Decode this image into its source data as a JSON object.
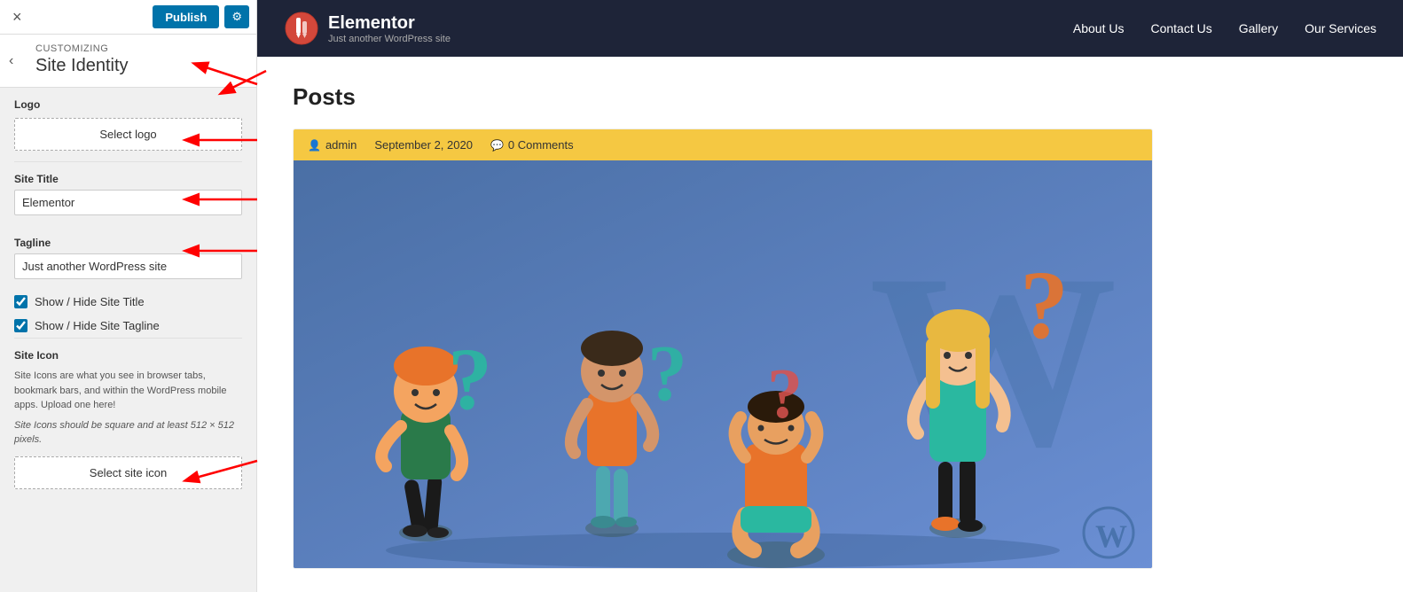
{
  "topbar": {
    "close_icon": "×",
    "publish_label": "Publish",
    "gear_icon": "⚙"
  },
  "breadcrumb": {
    "parent": "Customizing",
    "title": "Site Identity"
  },
  "logo_section": {
    "label": "Logo",
    "select_label": "Select logo"
  },
  "site_title_section": {
    "label": "Site Title",
    "value": "Elementor"
  },
  "tagline_section": {
    "label": "Tagline",
    "value": "Just another WordPress site"
  },
  "show_hide_title": {
    "label": "Show / Hide Site Title",
    "checked": true
  },
  "show_hide_tagline": {
    "label": "Show / Hide Site Tagline",
    "checked": true
  },
  "site_icon": {
    "title": "Site Icon",
    "desc": "Site Icons are what you see in browser tabs, bookmark bars, and within the WordPress mobile apps. Upload one here!",
    "note": "Site Icons should be square and at least 512 × 512 pixels.",
    "select_label": "Select site icon"
  },
  "header": {
    "site_name": "Elementor",
    "site_tagline": "Just another WordPress site",
    "nav_items": [
      "About Us",
      "Contact Us",
      "Gallery",
      "Our Services"
    ]
  },
  "main": {
    "page_title": "Posts",
    "post_meta": {
      "author": "admin",
      "date": "September 2, 2020",
      "comments": "0 Comments"
    }
  }
}
